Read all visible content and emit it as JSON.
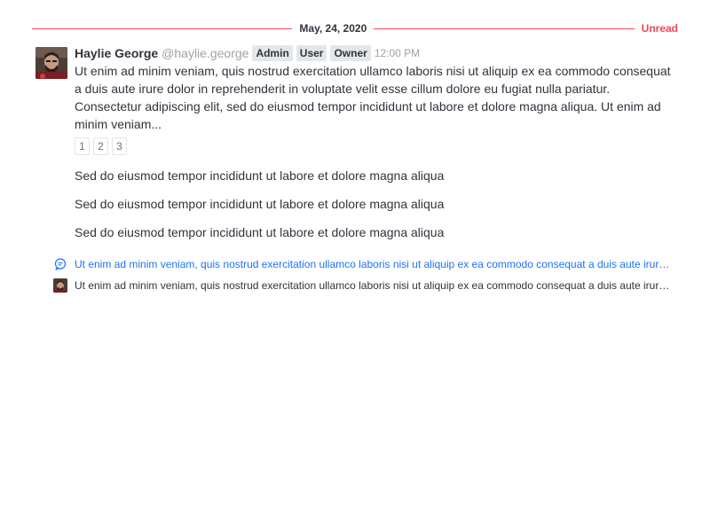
{
  "divider": {
    "date": "May, 24, 2020",
    "unread_label": "Unread"
  },
  "message": {
    "author_name": "Haylie George",
    "username": "@haylie.george",
    "roles": [
      "Admin",
      "User",
      "Owner"
    ],
    "time": "12:00 PM",
    "body": "Ut enim ad minim veniam, quis nostrud exercitation ullamco laboris nisi ut aliquip ex ea commodo consequat a duis aute irure dolor in reprehenderit in voluptate velit esse cillum dolore eu fugiat nulla pariatur. Consectetur adipiscing elit, sed do eiusmod tempor incididunt ut labore et dolore magna aliqua. Ut enim ad minim veniam...",
    "tabs": [
      "1",
      "2",
      "3"
    ],
    "lines": [
      "Sed do eiusmod tempor incididunt ut labore et dolore magna aliqua",
      "Sed do eiusmod tempor incididunt ut labore et dolore magna aliqua",
      "Sed do eiusmod tempor incididunt ut labore et dolore magna aliqua"
    ]
  },
  "thread": {
    "reply_link": "Ut enim ad minim veniam, quis nostrud exercitation ullamco laboris nisi ut aliquip ex ea commodo consequat a duis aute irure dolor in reprehenderit",
    "reply_preview": "Ut enim ad minim veniam, quis nostrud exercitation ullamco laboris nisi ut aliquip ex ea commodo consequat a duis aute irure dolor in reprehenderit"
  },
  "colors": {
    "unread_accent": "#f5455c",
    "link_blue": "#1d74f5"
  },
  "icons": {
    "thread_icon": "discussion-icon"
  }
}
